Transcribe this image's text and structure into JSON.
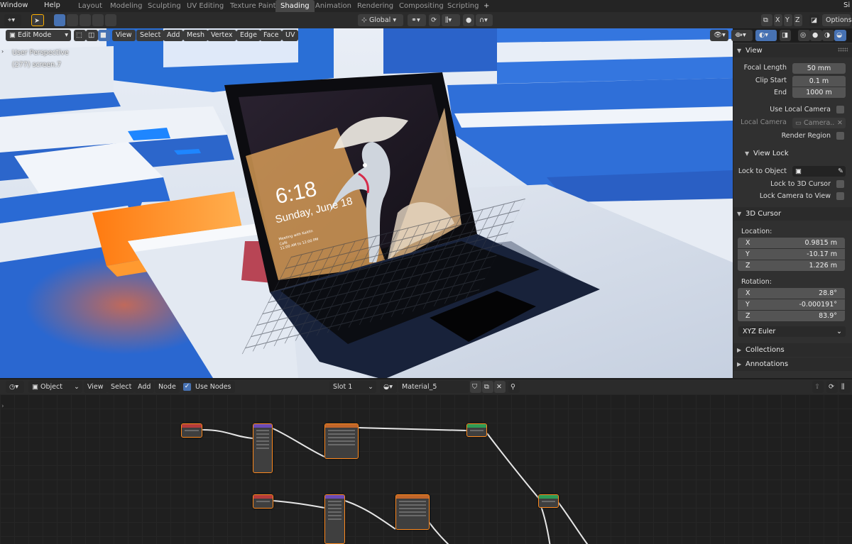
{
  "menus": [
    "Window",
    "Help"
  ],
  "workspaces": [
    {
      "label": "Layout",
      "active": false
    },
    {
      "label": "Modeling",
      "active": false
    },
    {
      "label": "Sculpting",
      "active": false
    },
    {
      "label": "UV Editing",
      "active": false
    },
    {
      "label": "Texture Paint",
      "active": false
    },
    {
      "label": "Shading",
      "active": true
    },
    {
      "label": "Animation",
      "active": false
    },
    {
      "label": "Rendering",
      "active": false
    },
    {
      "label": "Compositing",
      "active": false
    },
    {
      "label": "Scripting",
      "active": false
    }
  ],
  "add_tab": "+",
  "corner_label": "Si",
  "header": {
    "orientation": "Global",
    "axes": [
      "X",
      "Y",
      "Z"
    ],
    "options": "Options"
  },
  "viewport_header": {
    "mode": "Edit Mode",
    "menus": [
      "View",
      "Select",
      "Add",
      "Mesh",
      "Vertex",
      "Edge",
      "Face",
      "UV"
    ]
  },
  "overlay": {
    "perspective": "User Perspective",
    "object": "(277) screen.7"
  },
  "lockscreen": {
    "time": "6:18",
    "date": "Sunday, June 18",
    "notice1": "Meeting with Kaitlin",
    "notice2": "Café",
    "notice3": "11:00 AM to 12:00 PM"
  },
  "npanel": {
    "view_title": "View",
    "focal_label": "Focal Length",
    "focal_value": "50 mm",
    "clip_start_label": "Clip Start",
    "clip_start_value": "0.1 m",
    "end_label": "End",
    "end_value": "1000 m",
    "use_local_camera": "Use Local Camera",
    "local_camera_label": "Local Camera",
    "local_camera_value": "Camera..",
    "render_region": "Render Region",
    "view_lock_title": "View Lock",
    "lock_object_label": "Lock to Object",
    "lock_cursor": "Lock to 3D Cursor",
    "lock_camera": "Lock Camera to View",
    "cursor_title": "3D Cursor",
    "location_label": "Location:",
    "location": [
      {
        "axis": "X",
        "value": "0.9815 m"
      },
      {
        "axis": "Y",
        "value": "-10.17 m"
      },
      {
        "axis": "Z",
        "value": "1.226 m"
      }
    ],
    "rotation_label": "Rotation:",
    "rotation": [
      {
        "axis": "X",
        "value": "28.8°"
      },
      {
        "axis": "Y",
        "value": "-0.000191°"
      },
      {
        "axis": "Z",
        "value": "83.9°"
      }
    ],
    "rotation_mode": "XYZ Euler",
    "collections": "Collections",
    "annotations": "Annotations"
  },
  "node_header": {
    "object": "Object",
    "menus": [
      "View",
      "Select",
      "Add",
      "Node"
    ],
    "use_nodes": "Use Nodes",
    "slot": "Slot 1",
    "material": "Material_5"
  },
  "colors": {
    "accent": "#4772b3",
    "node_selected": "#ff8a1f",
    "scene_blue": "#2a6fd6",
    "glow": "#ff8a1a"
  }
}
